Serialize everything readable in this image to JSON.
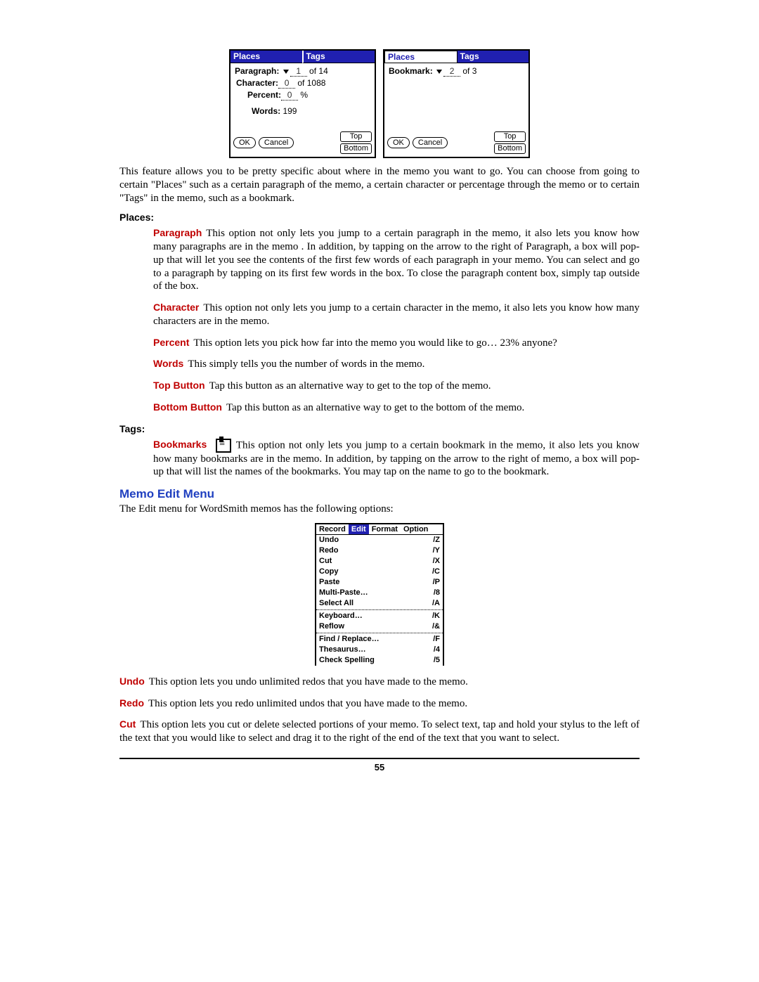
{
  "dialogs": {
    "left": {
      "tab_places": "Places",
      "tab_tags": "Tags",
      "row_paragraph_label": "Paragraph:",
      "row_paragraph_val": "1",
      "row_paragraph_of": "of 14",
      "row_character_label": "Character:",
      "row_character_val": "0",
      "row_character_of": "of 1088",
      "row_percent_label": "Percent:",
      "row_percent_val": "0",
      "row_percent_suffix": "%",
      "row_words_label": "Words:",
      "row_words_val": "199",
      "btn_ok": "OK",
      "btn_cancel": "Cancel",
      "btn_top": "Top",
      "btn_bottom": "Bottom"
    },
    "right": {
      "tab_places": "Places",
      "tab_tags": "Tags",
      "row_bookmark_label": "Bookmark:",
      "row_bookmark_val": "2",
      "row_bookmark_of": "of 3",
      "btn_ok": "OK",
      "btn_cancel": "Cancel",
      "btn_top": "Top",
      "btn_bottom": "Bottom"
    }
  },
  "intro": "This feature allows you to be pretty specific about where in the memo you want to go.  You can choose from going to certain \"Places\" such as a certain paragraph of the memo, a certain character or percentage through the memo or to certain \"Tags\" in the memo, such as a bookmark.",
  "places_label": "Places:",
  "places": {
    "paragraph_t": "Paragraph",
    "paragraph": "This option not only lets you jump to a certain paragraph in the memo, it also lets you know how many paragraphs are in the memo .  In addition, by tapping on the arrow to the right of Paragraph, a box will pop-up that will let you see the contents of the first few words of each paragraph in your memo.  You can select and go to a paragraph by tapping on its first few words in the box.  To close the paragraph content box, simply tap outside of the box.",
    "character_t": "Character",
    "character": "This option not only lets you jump to a certain character in the memo, it also lets you know how many characters are in the memo.",
    "percent_t": "Percent",
    "percent": "This option lets you pick how far into the memo you would like to go… 23% anyone?",
    "words_t": "Words",
    "words": "This simply tells you the number of words in the memo.",
    "top_t": "Top Button",
    "top": "Tap this button as an alternative way to get to the top of the memo.",
    "bottom_t": "Bottom Button",
    "bottom": "Tap this button as an alternative way to get to the bottom of the memo."
  },
  "tags_label": "Tags:",
  "tags": {
    "bookmarks_t": "Bookmarks",
    "bookmarks": "This option not only lets you jump to a certain bookmark in the memo, it also lets you know how many bookmarks are in the memo.  In addition, by tapping on the arrow to the right of memo, a box will pop-up that will list the names of the bookmarks.  You may tap on the name to go to the bookmark."
  },
  "edit_heading": "Memo Edit Menu",
  "edit_intro": "The Edit menu for WordSmith memos has the following options:",
  "menubar": {
    "record": "Record",
    "edit": "Edit",
    "format": "Format",
    "option": "Option"
  },
  "menu_items": [
    {
      "label": "Undo",
      "sc": "/Z"
    },
    {
      "label": "Redo",
      "sc": "/Y"
    },
    {
      "label": "Cut",
      "sc": "/X"
    },
    {
      "label": "Copy",
      "sc": "/C"
    },
    {
      "label": "Paste",
      "sc": "/P"
    },
    {
      "label": "Multi-Paste…",
      "sc": "/8"
    },
    {
      "label": "Select All",
      "sc": "/A"
    }
  ],
  "menu_items2": [
    {
      "label": "Keyboard…",
      "sc": "/K"
    },
    {
      "label": "Reflow",
      "sc": "/&"
    }
  ],
  "menu_items3": [
    {
      "label": "Find / Replace…",
      "sc": "/F"
    },
    {
      "label": "Thesaurus…",
      "sc": "/4"
    },
    {
      "label": "Check Spelling",
      "sc": "/5"
    }
  ],
  "edit_defs": {
    "undo_t": "Undo",
    "undo": "This option lets you undo unlimited redos that you have made to the memo.",
    "redo_t": "Redo",
    "redo": "This option lets you redo unlimited undos that you have made to the memo.",
    "cut_t": "Cut",
    "cut": "This option lets you cut or delete selected portions of your memo.  To select text, tap and hold your stylus to the left of the text that you would like to select and drag it to the right of the end of the text that you want to select."
  },
  "page_number": "55"
}
